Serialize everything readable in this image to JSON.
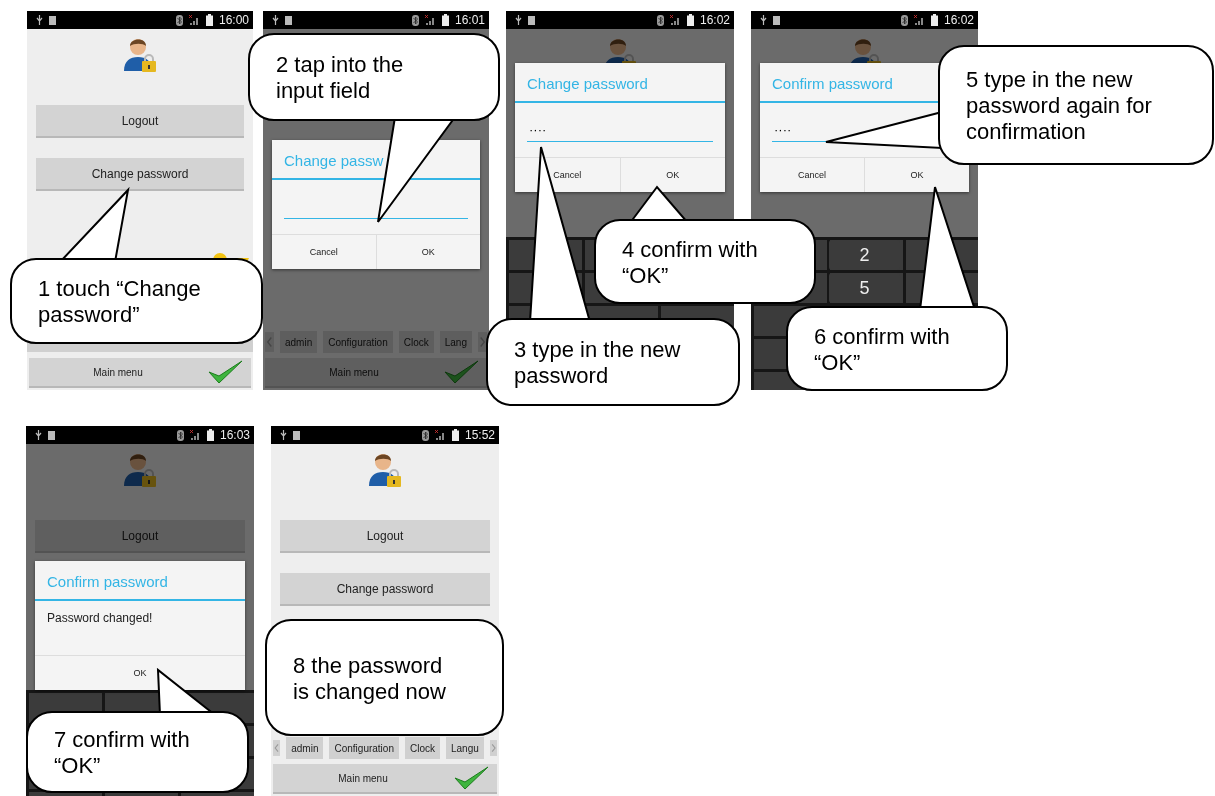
{
  "screens": [
    {
      "time": "16:00",
      "dimmed": false,
      "avatar": true,
      "buttons": [
        "Logout",
        "Change password"
      ],
      "key_icon": true,
      "blank_tab_bar": true,
      "main_menu": "Main menu"
    },
    {
      "time": "16:01",
      "dimmed": true,
      "tabs": [
        "admin",
        "Configuration",
        "Clock",
        "Lang"
      ],
      "main_menu": "Main menu",
      "dialog": {
        "title": "Change passw",
        "input": {
          "focused": true
        },
        "buttons": [
          "Cancel",
          "OK"
        ]
      }
    },
    {
      "time": "16:02",
      "dimmed": true,
      "avatar": true,
      "dialog": {
        "title": "Change password",
        "input": {
          "value": "····",
          "focused": true
        },
        "buttons": [
          "Cancel",
          "OK"
        ]
      },
      "keypad": {
        "visible": true
      }
    },
    {
      "time": "16:02",
      "dimmed": true,
      "avatar": true,
      "dialog": {
        "title": "Confirm password",
        "input": {
          "value": "····",
          "focused": true
        },
        "buttons": [
          "Cancel",
          "OK"
        ]
      },
      "keypad": {
        "visible": true,
        "middle_keys": [
          "2",
          "5"
        ]
      }
    },
    {
      "time": "16:03",
      "dimmed": true,
      "avatar": true,
      "buttons": [
        "Logout"
      ],
      "dialog": {
        "title": "Confirm password",
        "message": "Password changed!",
        "buttons": [
          "OK"
        ]
      },
      "keypad": {
        "visible": true
      }
    },
    {
      "time": "15:52",
      "dimmed": false,
      "avatar": true,
      "buttons": [
        "Logout",
        "Change password"
      ],
      "tabs": [
        "admin",
        "Configuration",
        "Clock",
        "Langu"
      ],
      "main_menu": "Main menu"
    }
  ],
  "callouts": [
    {
      "text": "1 touch “Change password”"
    },
    {
      "text": "2 tap into the input field"
    },
    {
      "text": "3 type in the new password"
    },
    {
      "text": "4 confirm with “OK”"
    },
    {
      "text": "5 type in the new password again for confirmation"
    },
    {
      "text": "6 confirm with “OK”"
    },
    {
      "text": "7 confirm with “OK”"
    },
    {
      "text": "8 the password is changed now"
    }
  ]
}
